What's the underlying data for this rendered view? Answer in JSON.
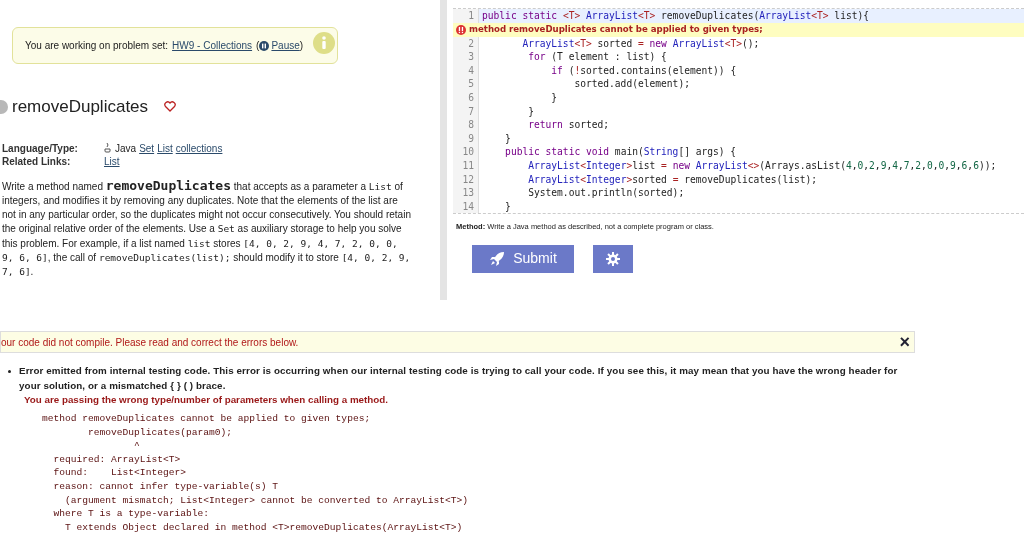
{
  "notice": {
    "text": "You are working on problem set:",
    "set_link": "HW9 - Collections",
    "open": "(",
    "pause_link": "Pause",
    "close": ")"
  },
  "problem": {
    "title": "removeDuplicates",
    "favorite": false
  },
  "meta": [
    {
      "label": "Language/Type:",
      "plain": "Java",
      "links": [
        "Set",
        "List",
        "collections"
      ]
    },
    {
      "label": "Related Links:",
      "links": [
        "List"
      ]
    }
  ],
  "description": [
    {
      "kind": "text",
      "text": "Write a method named "
    },
    {
      "kind": "big_code",
      "text": "removeDuplicates"
    },
    {
      "kind": "text",
      "text": " that accepts as a parameter a "
    },
    {
      "kind": "code",
      "text": "List"
    },
    {
      "kind": "text",
      "text": " of integers, and modifies it by removing any duplicates. Note that the elements of the list are not in any particular order, so the duplicates might not occur consecutively. You should retain the original relative order of the elements. Use a "
    },
    {
      "kind": "code",
      "text": "Set"
    },
    {
      "kind": "text",
      "text": " as auxiliary storage to help you solve this problem. For example, if a list named "
    },
    {
      "kind": "code",
      "text": "list"
    },
    {
      "kind": "text",
      "text": " stores "
    },
    {
      "kind": "code",
      "text": "[4, 0, 2, 9, 4, 7, 2, 0, 0, 9, 6, 6]"
    },
    {
      "kind": "text",
      "text": ", the call of "
    },
    {
      "kind": "code",
      "text": "removeDuplicates(list);"
    },
    {
      "kind": "text",
      "text": " should modify it to store "
    },
    {
      "kind": "code",
      "text": "[4, 0, 2, 9, 7, 6]"
    },
    {
      "kind": "text",
      "text": "."
    }
  ],
  "editor": {
    "lines": [
      {
        "number": "1",
        "highlighted": true,
        "tokens": [
          {
            "kind": "keyword",
            "text": "public static "
          },
          {
            "kind": "operator",
            "text": "<T>"
          },
          {
            "kind": "type",
            "text": " ArrayList"
          },
          {
            "kind": "operator",
            "text": "<T>"
          },
          {
            "kind": "plain",
            "text": " removeDuplicates("
          },
          {
            "kind": "type",
            "text": "ArrayList"
          },
          {
            "kind": "operator",
            "text": "<T>"
          },
          {
            "kind": "plain",
            "text": " list){"
          }
        ],
        "error": "method removeDuplicates cannot be applied to given types;"
      },
      {
        "number": "2",
        "highlighted": false,
        "tokens": [
          {
            "kind": "type",
            "text": "       ArrayList"
          },
          {
            "kind": "operator",
            "text": "<T>"
          },
          {
            "kind": "plain",
            "text": " sorted "
          },
          {
            "kind": "operator",
            "text": "="
          },
          {
            "kind": "keyword",
            "text": " new "
          },
          {
            "kind": "type",
            "text": "ArrayList"
          },
          {
            "kind": "operator",
            "text": "<T>"
          },
          {
            "kind": "plain",
            "text": "();"
          }
        ]
      },
      {
        "number": "3",
        "highlighted": false,
        "tokens": [
          {
            "kind": "keyword",
            "text": "        for"
          },
          {
            "kind": "plain",
            "text": " (T element : list) {"
          }
        ]
      },
      {
        "number": "4",
        "highlighted": false,
        "tokens": [
          {
            "kind": "keyword",
            "text": "            if"
          },
          {
            "kind": "plain",
            "text": " ("
          },
          {
            "kind": "operator",
            "text": "!"
          },
          {
            "kind": "plain",
            "text": "sorted.contains(element)) {"
          }
        ]
      },
      {
        "number": "5",
        "highlighted": false,
        "tokens": [
          {
            "kind": "plain",
            "text": "                sorted.add(element);"
          }
        ]
      },
      {
        "number": "6",
        "highlighted": false,
        "tokens": [
          {
            "kind": "plain",
            "text": "            }"
          }
        ]
      },
      {
        "number": "7",
        "highlighted": false,
        "tokens": [
          {
            "kind": "plain",
            "text": "        }"
          }
        ]
      },
      {
        "number": "8",
        "highlighted": false,
        "tokens": [
          {
            "kind": "keyword",
            "text": "        return"
          },
          {
            "kind": "plain",
            "text": " sorted;"
          }
        ]
      },
      {
        "number": "9",
        "highlighted": false,
        "tokens": [
          {
            "kind": "plain",
            "text": "    }"
          }
        ]
      },
      {
        "number": "10",
        "highlighted": false,
        "tokens": [
          {
            "kind": "keyword",
            "text": "    public static void"
          },
          {
            "kind": "plain",
            "text": " main("
          },
          {
            "kind": "type",
            "text": "String"
          },
          {
            "kind": "plain",
            "text": "[] args) {"
          }
        ]
      },
      {
        "number": "11",
        "highlighted": false,
        "tokens": [
          {
            "kind": "type",
            "text": "        ArrayList"
          },
          {
            "kind": "operator",
            "text": "<"
          },
          {
            "kind": "type",
            "text": "Integer"
          },
          {
            "kind": "operator",
            "text": ">"
          },
          {
            "kind": "plain",
            "text": "list "
          },
          {
            "kind": "operator",
            "text": "="
          },
          {
            "kind": "keyword",
            "text": " new "
          },
          {
            "kind": "type",
            "text": "ArrayList"
          },
          {
            "kind": "operator",
            "text": "<>"
          },
          {
            "kind": "plain",
            "text": "(Arrays.asList("
          },
          {
            "kind": "number",
            "text": "4"
          },
          {
            "kind": "plain",
            "text": ","
          },
          {
            "kind": "number",
            "text": "0"
          },
          {
            "kind": "plain",
            "text": ","
          },
          {
            "kind": "number",
            "text": "2"
          },
          {
            "kind": "plain",
            "text": ","
          },
          {
            "kind": "number",
            "text": "9"
          },
          {
            "kind": "plain",
            "text": ","
          },
          {
            "kind": "number",
            "text": "4"
          },
          {
            "kind": "plain",
            "text": ","
          },
          {
            "kind": "number",
            "text": "7"
          },
          {
            "kind": "plain",
            "text": ","
          },
          {
            "kind": "number",
            "text": "2"
          },
          {
            "kind": "plain",
            "text": ","
          },
          {
            "kind": "number",
            "text": "0"
          },
          {
            "kind": "plain",
            "text": ","
          },
          {
            "kind": "number",
            "text": "0"
          },
          {
            "kind": "plain",
            "text": ","
          },
          {
            "kind": "number",
            "text": "9"
          },
          {
            "kind": "plain",
            "text": ","
          },
          {
            "kind": "number",
            "text": "6"
          },
          {
            "kind": "plain",
            "text": ","
          },
          {
            "kind": "number",
            "text": "6"
          },
          {
            "kind": "plain",
            "text": "));"
          }
        ]
      },
      {
        "number": "12",
        "highlighted": false,
        "tokens": [
          {
            "kind": "type",
            "text": "        ArrayList"
          },
          {
            "kind": "operator",
            "text": "<"
          },
          {
            "kind": "type",
            "text": "Integer"
          },
          {
            "kind": "operator",
            "text": ">"
          },
          {
            "kind": "plain",
            "text": "sorted "
          },
          {
            "kind": "operator",
            "text": "="
          },
          {
            "kind": "plain",
            "text": " removeDuplicates(list);"
          }
        ]
      },
      {
        "number": "13",
        "highlighted": false,
        "tokens": [
          {
            "kind": "plain",
            "text": "        System.out.println(sorted);"
          }
        ]
      },
      {
        "number": "14",
        "highlighted": false,
        "tokens": [
          {
            "kind": "plain",
            "text": "    }"
          }
        ]
      }
    ]
  },
  "method_note": {
    "label": "Method:",
    "text": "Write a Java method as described, not a complete program or class."
  },
  "buttons": {
    "submit": "Submit"
  },
  "compile_error": {
    "banner": "our code did not compile. Please read and correct the errors below.",
    "close": "×",
    "items": [
      {
        "text": "Error emitted from internal testing code. This error is occurring when our internal testing code is trying to call your code. If you see this, it may mean that you have the wrong header for your solution, or a mismatched { } ( ) brace.",
        "hint": "You are passing the wrong type/number of parameters when calling a method.",
        "details": [
          "method removeDuplicates cannot be applied to given types;",
          "        removeDuplicates(param0);",
          "                ^",
          "  required: ArrayList<T>",
          "  found:    List<Integer>",
          "  reason: cannot infer type-variable(s) T",
          "    (argument mismatch; List<Integer> cannot be converted to ArrayList<T>)",
          "  where T is a type-variable:",
          "    T extends Object declared in method <T>removeDuplicates(ArrayList<T>)"
        ]
      }
    ]
  }
}
